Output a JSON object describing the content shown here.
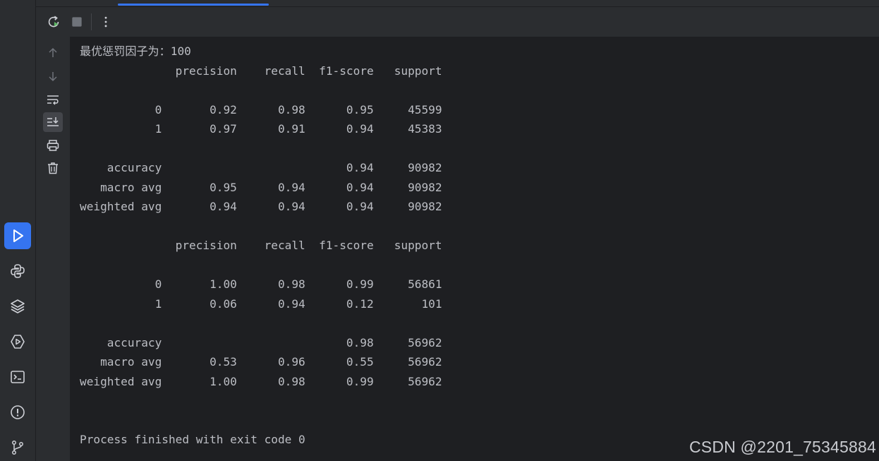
{
  "run_panel": {
    "toolbar": {
      "rerun_icon": "rerun-icon",
      "stop_icon": "stop-icon",
      "more_icon": "more-vertical-icon"
    },
    "actions": [
      "arrow-up-icon",
      "arrow-down-icon",
      "soft-wrap-icon",
      "scroll-to-end-icon",
      "print-icon",
      "trash-icon"
    ]
  },
  "left_stripe": {
    "items": [
      "run-icon",
      "python-console-icon",
      "layers-icon",
      "services-icon",
      "terminal-icon",
      "problems-icon",
      "git-icon"
    ],
    "active_color": "#3574f0"
  },
  "console": {
    "lines": [
      "最优惩罚因子为：100",
      "              precision    recall  f1-score   support",
      "",
      "           0       0.92      0.98      0.95     45599",
      "           1       0.97      0.91      0.94     45383",
      "",
      "    accuracy                           0.94     90982",
      "   macro avg       0.95      0.94      0.94     90982",
      "weighted avg       0.94      0.94      0.94     90982",
      "",
      "              precision    recall  f1-score   support",
      "",
      "           0       1.00      0.98      0.99     56861",
      "           1       0.06      0.94      0.12       101",
      "",
      "    accuracy                           0.98     56962",
      "   macro avg       0.53      0.96      0.55     56962",
      "weighted avg       1.00      0.98      0.99     56962",
      "",
      "",
      "Process finished with exit code 0"
    ]
  },
  "watermark": "CSDN @2201_75345884"
}
